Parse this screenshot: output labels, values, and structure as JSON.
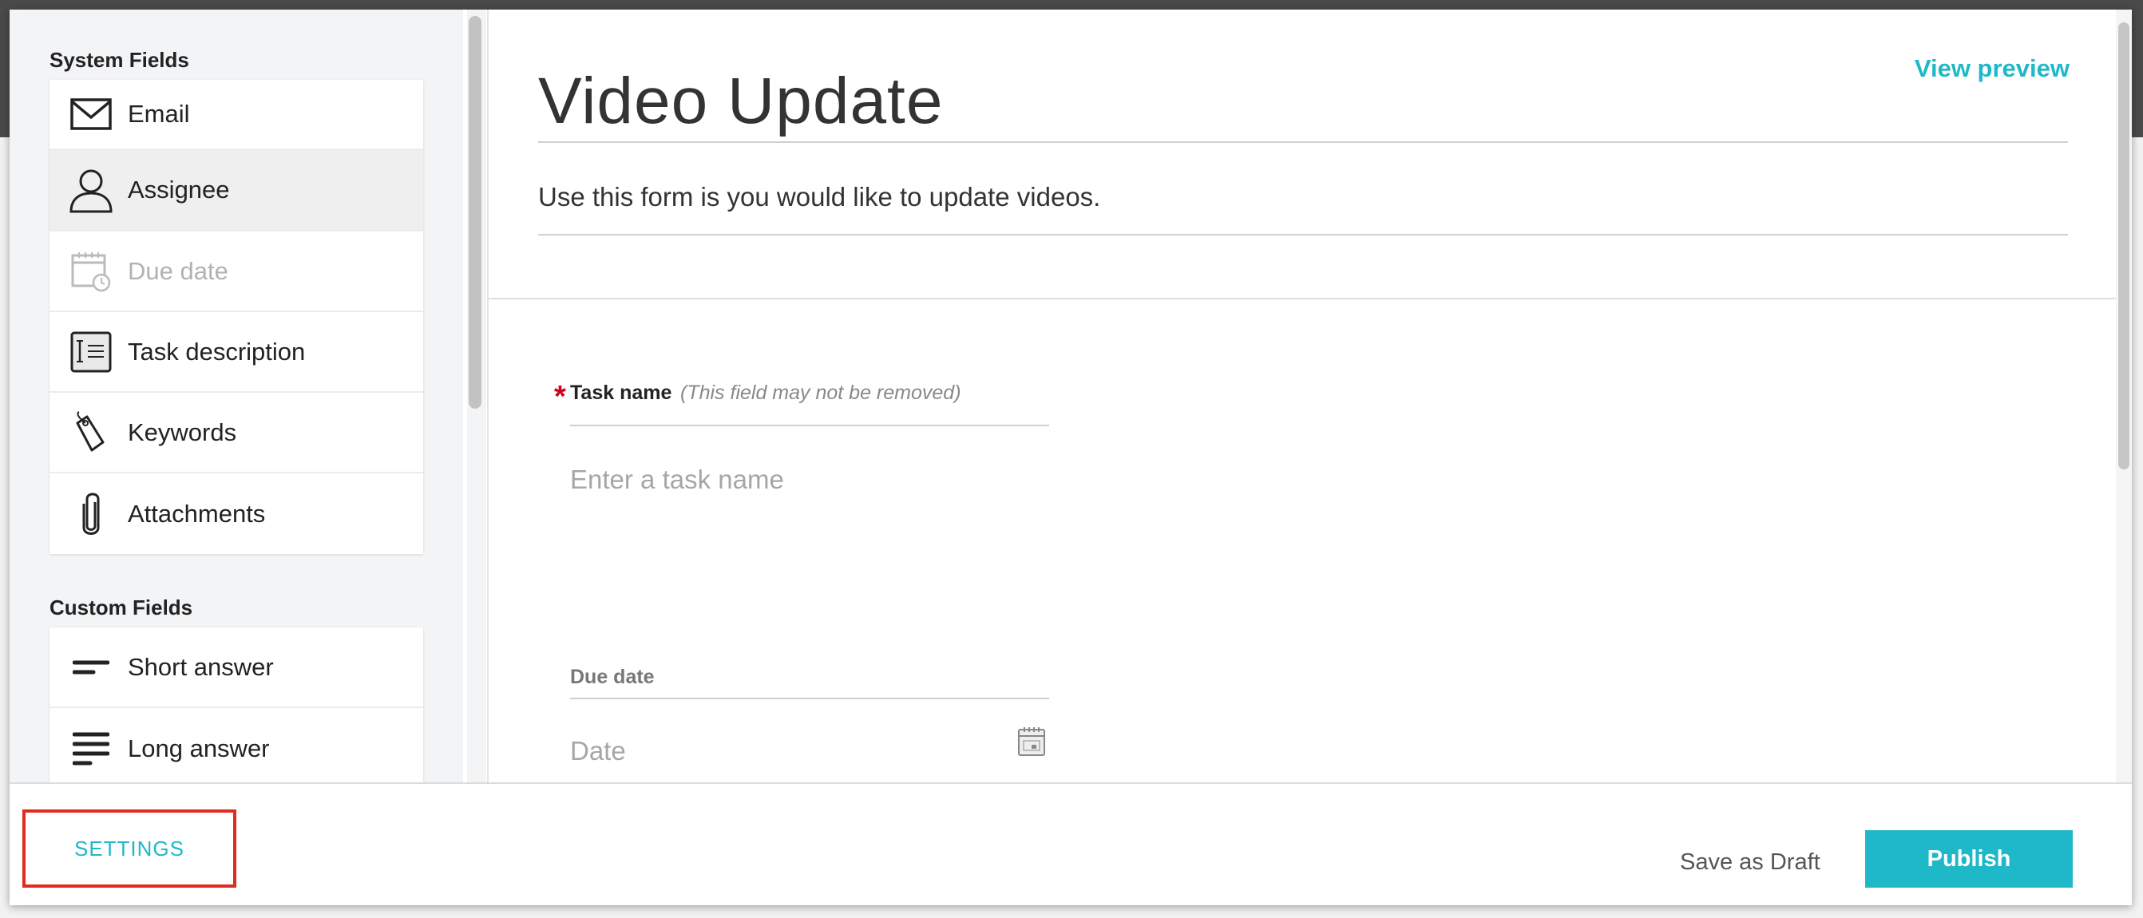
{
  "page": {
    "title": "Video Update",
    "view_preview": "View preview",
    "description": "Use this form is you would like to update videos."
  },
  "sidebar": {
    "system_title": "System Fields",
    "system_items": [
      {
        "label": "Email",
        "icon": "envelope-icon"
      },
      {
        "label": "Assignee",
        "icon": "person-icon",
        "state": "active"
      },
      {
        "label": "Due date",
        "icon": "calendar-icon",
        "state": "disabled"
      },
      {
        "label": "Task description",
        "icon": "text-block-icon"
      },
      {
        "label": "Keywords",
        "icon": "tag-icon"
      },
      {
        "label": "Attachments",
        "icon": "paperclip-icon"
      }
    ],
    "custom_title": "Custom Fields",
    "custom_items": [
      {
        "label": "Short answer",
        "icon": "short-lines-icon"
      },
      {
        "label": "Long answer",
        "icon": "long-lines-icon"
      }
    ]
  },
  "form": {
    "task_name": {
      "label": "Task name",
      "note": "(This field may not be removed)",
      "required_mark": "*",
      "placeholder": "Enter a task name"
    },
    "due_date": {
      "label": "Due date",
      "placeholder": "Date"
    }
  },
  "footer": {
    "settings": "SETTINGS",
    "save_draft": "Save as Draft",
    "publish": "Publish"
  },
  "colors": {
    "accent": "#1fb8c8",
    "highlight_border": "#e02b20",
    "required": "#d0021b"
  }
}
